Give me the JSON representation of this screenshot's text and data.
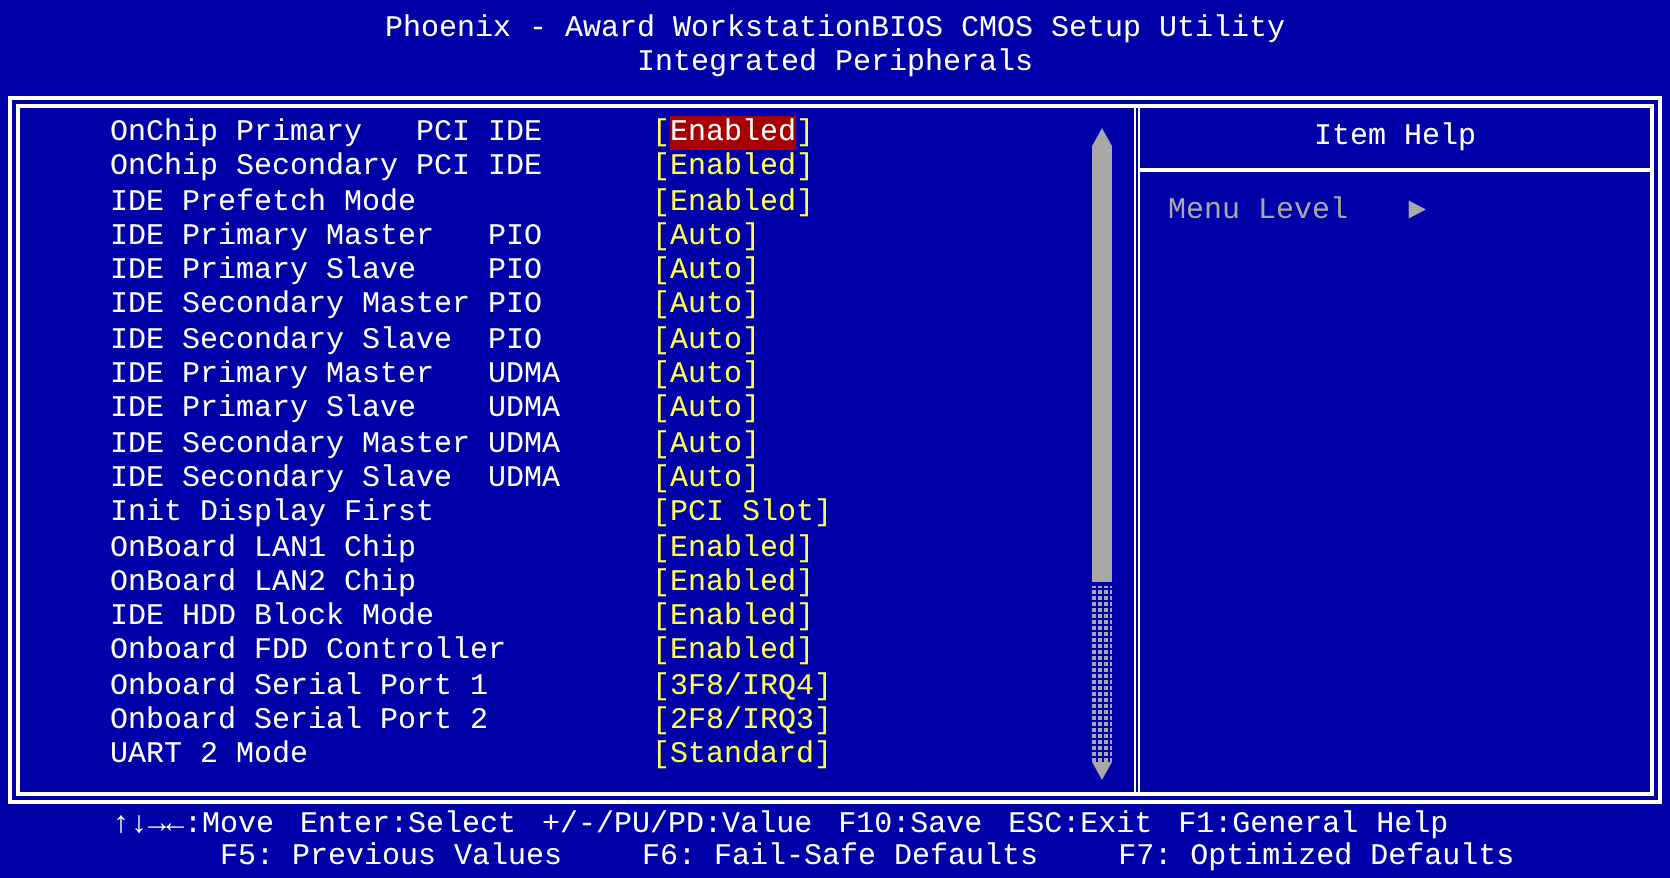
{
  "header": {
    "title": "Phoenix - Award WorkstationBIOS CMOS Setup Utility",
    "subtitle": "Integrated Peripherals"
  },
  "items": [
    {
      "label": "OnChip Primary   PCI IDE",
      "brackets": [
        "[",
        "]"
      ],
      "value": "Enabled",
      "selected": true
    },
    {
      "label": "OnChip Secondary PCI IDE",
      "brackets": [
        "[",
        "]"
      ],
      "value": "Enabled",
      "selected": false
    },
    {
      "label": "IDE Prefetch Mode",
      "brackets": [
        "[",
        "]"
      ],
      "value": "Enabled",
      "selected": false
    },
    {
      "label": "IDE Primary Master   PIO",
      "brackets": [
        "[",
        "]"
      ],
      "value": "Auto",
      "selected": false
    },
    {
      "label": "IDE Primary Slave    PIO",
      "brackets": [
        "[",
        "]"
      ],
      "value": "Auto",
      "selected": false
    },
    {
      "label": "IDE Secondary Master PIO",
      "brackets": [
        "[",
        "]"
      ],
      "value": "Auto",
      "selected": false
    },
    {
      "label": "IDE Secondary Slave  PIO",
      "brackets": [
        "[",
        "]"
      ],
      "value": "Auto",
      "selected": false
    },
    {
      "label": "IDE Primary Master   UDMA",
      "brackets": [
        "[",
        "]"
      ],
      "value": "Auto",
      "selected": false
    },
    {
      "label": "IDE Primary Slave    UDMA",
      "brackets": [
        "[",
        "]"
      ],
      "value": "Auto",
      "selected": false
    },
    {
      "label": "IDE Secondary Master UDMA",
      "brackets": [
        "[",
        "]"
      ],
      "value": "Auto",
      "selected": false
    },
    {
      "label": "IDE Secondary Slave  UDMA",
      "brackets": [
        "[",
        "]"
      ],
      "value": "Auto",
      "selected": false
    },
    {
      "label": "Init Display First",
      "brackets": [
        "[",
        "]"
      ],
      "value": "PCI Slot",
      "selected": false
    },
    {
      "label": "OnBoard LAN1 Chip",
      "brackets": [
        "[",
        "]"
      ],
      "value": "Enabled",
      "selected": false
    },
    {
      "label": "OnBoard LAN2 Chip",
      "brackets": [
        "[",
        "]"
      ],
      "value": "Enabled",
      "selected": false
    },
    {
      "label": "IDE HDD Block Mode",
      "brackets": [
        "[",
        "]"
      ],
      "value": "Enabled",
      "selected": false
    },
    {
      "label": "Onboard FDD Controller",
      "brackets": [
        "[",
        "]"
      ],
      "value": "Enabled",
      "selected": false
    },
    {
      "label": "Onboard Serial Port 1",
      "brackets": [
        "[",
        "]"
      ],
      "value": "3F8/IRQ4",
      "selected": false
    },
    {
      "label": "Onboard Serial Port 2",
      "brackets": [
        "[",
        "]"
      ],
      "value": "2F8/IRQ3",
      "selected": false
    },
    {
      "label": "UART 2 Mode",
      "brackets": [
        "[",
        "]"
      ],
      "value": "Standard",
      "selected": false
    }
  ],
  "help": {
    "title": "Item Help",
    "menu_level": {
      "label": "Menu Level",
      "symbol": "►"
    }
  },
  "footer": [
    [
      "↑↓→←:Move",
      "Enter:Select",
      "+/-/PU/PD:Value",
      "F10:Save",
      "ESC:Exit",
      "F1:General Help"
    ],
    [
      "F5: Previous Values",
      "F6: Fail-Safe Defaults",
      "F7: Optimized Defaults"
    ]
  ]
}
